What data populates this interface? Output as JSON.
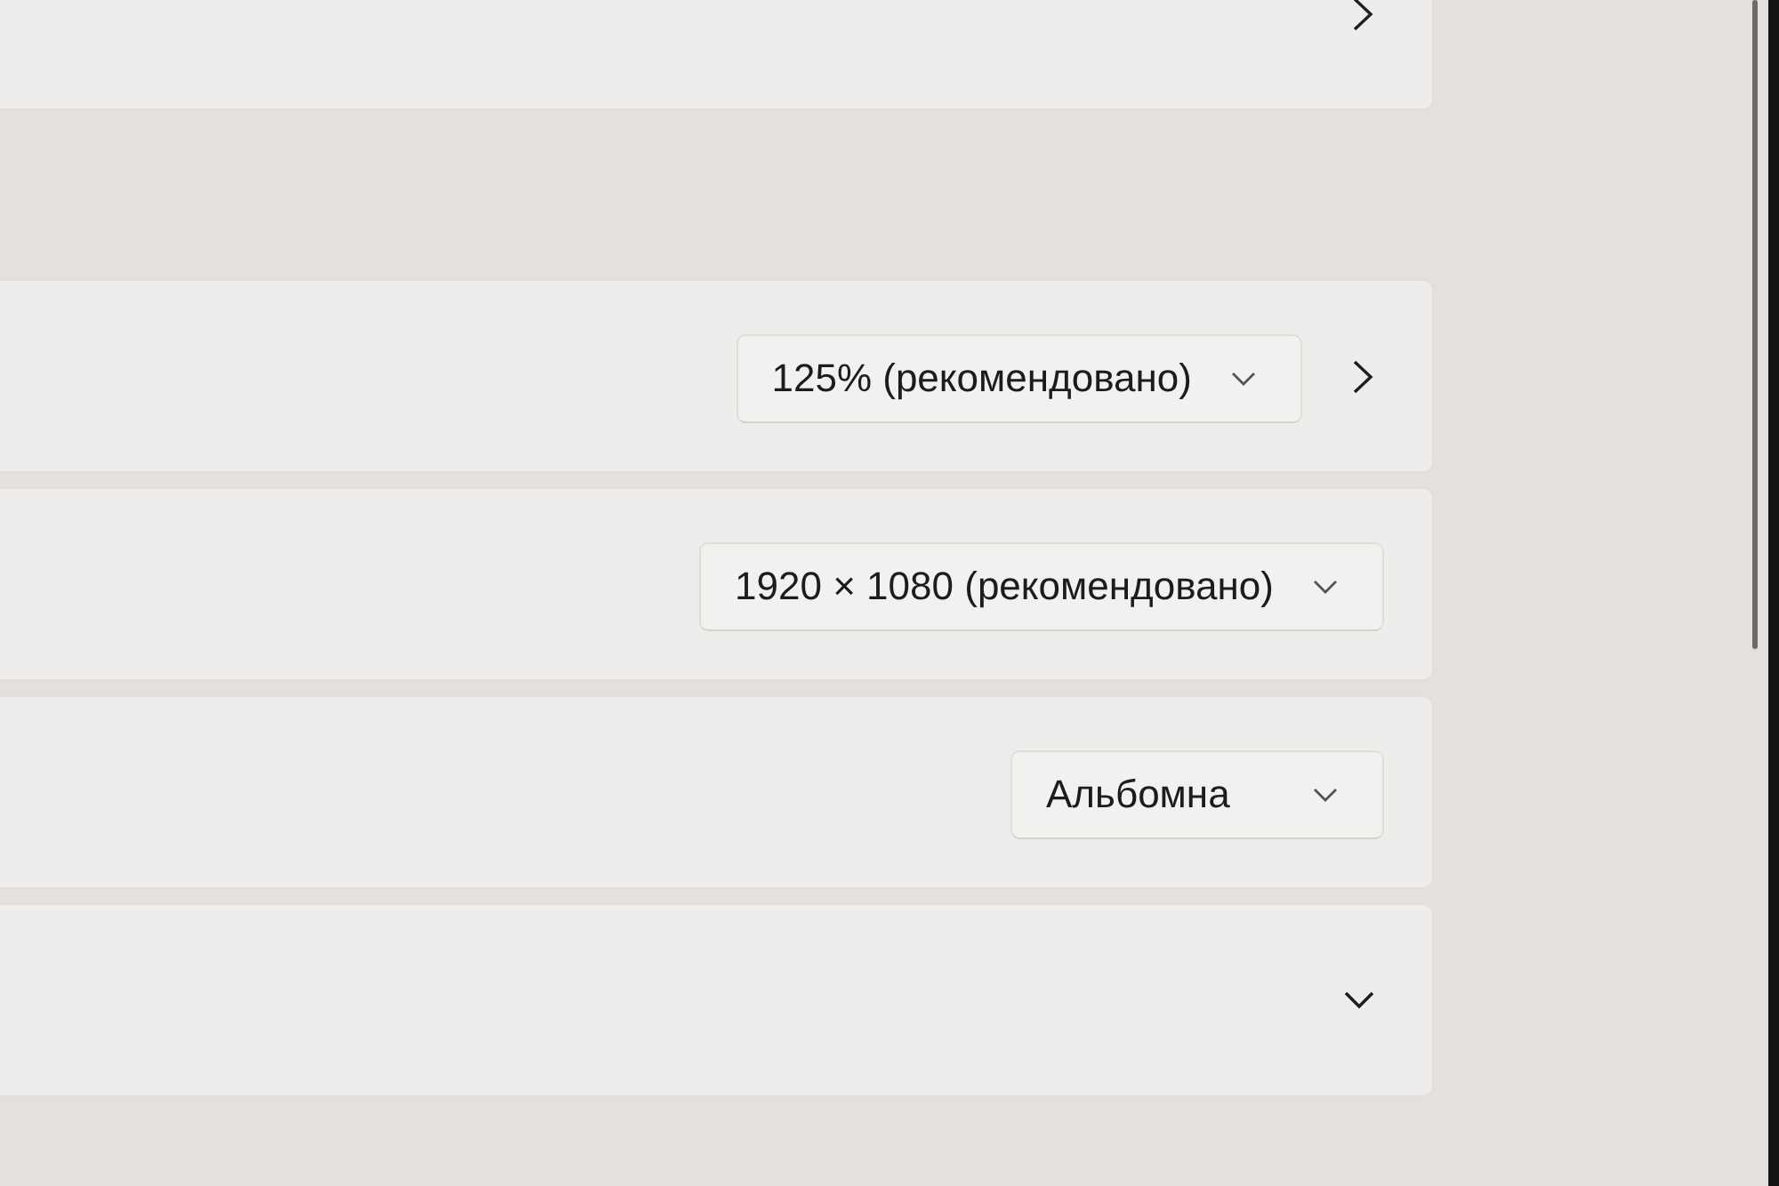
{
  "sections": [
    {
      "cards": [
        {
          "kind": "link"
        }
      ]
    },
    {
      "cards": [
        {
          "kind": "dropdown_link",
          "dropdown": {
            "value": "125% (рекомендовано)"
          }
        },
        {
          "kind": "dropdown",
          "dropdown": {
            "value": "1920 × 1080 (рекомендовано)"
          }
        },
        {
          "kind": "dropdown",
          "dropdown": {
            "value": "Альбомна"
          }
        },
        {
          "kind": "expander",
          "expanded": false
        }
      ]
    }
  ]
}
